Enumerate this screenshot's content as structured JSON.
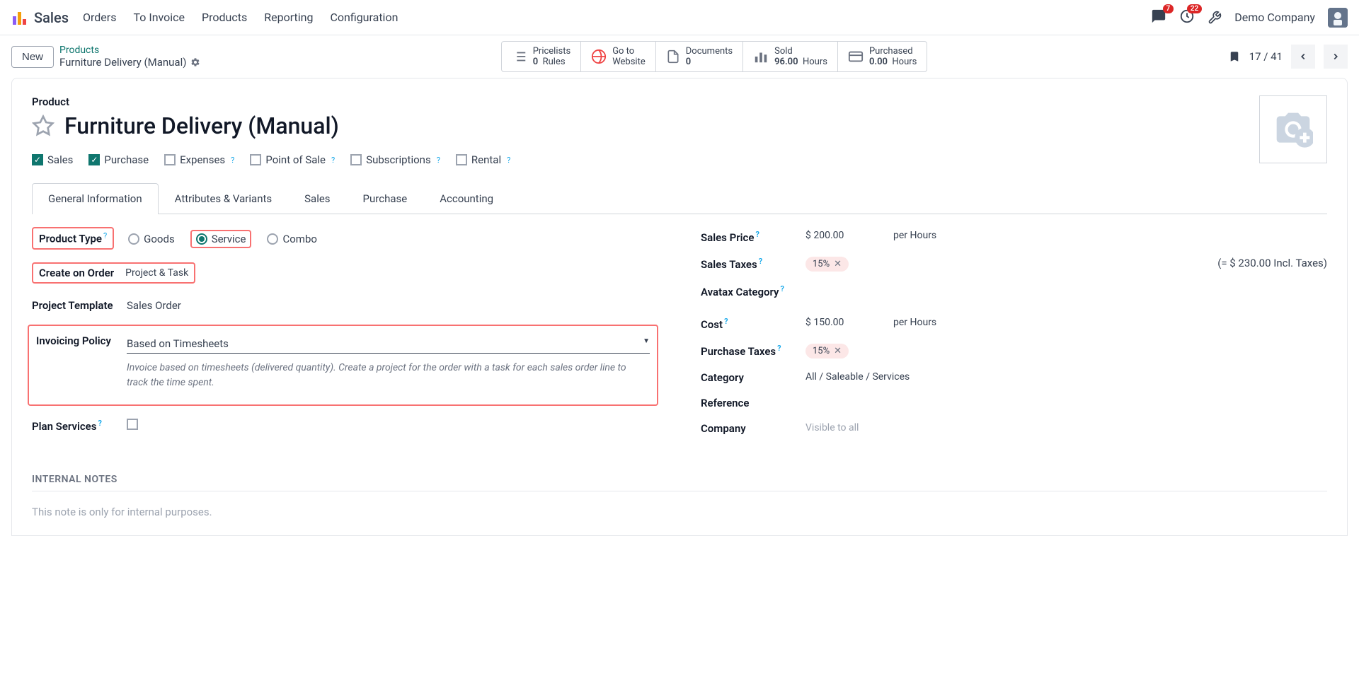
{
  "nav": {
    "app": "Sales",
    "items": [
      "Orders",
      "To Invoice",
      "Products",
      "Reporting",
      "Configuration"
    ],
    "messages_badge": "7",
    "activities_badge": "22",
    "company": "Demo Company"
  },
  "control": {
    "new": "New",
    "breadcrumb_link": "Products",
    "breadcrumb_title": "Furniture Delivery (Manual)",
    "stats": {
      "pricelists": {
        "label": "Pricelists",
        "count": "0",
        "unit": "Rules"
      },
      "goto": {
        "label": "Go to",
        "unit": "Website"
      },
      "documents": {
        "label": "Documents",
        "count": "0"
      },
      "sold": {
        "label": "Sold",
        "value": "96.00",
        "unit": "Hours"
      },
      "purchased": {
        "label": "Purchased",
        "value": "0.00",
        "unit": "Hours"
      }
    },
    "pager": "17 / 41"
  },
  "form": {
    "label": "Product",
    "title": "Furniture Delivery (Manual)",
    "options": {
      "sales": "Sales",
      "purchase": "Purchase",
      "expenses": "Expenses",
      "pos": "Point of Sale",
      "subscriptions": "Subscriptions",
      "rental": "Rental"
    },
    "tabs": [
      "General Information",
      "Attributes & Variants",
      "Sales",
      "Purchase",
      "Accounting"
    ],
    "left": {
      "product_type": {
        "label": "Product Type",
        "options": {
          "goods": "Goods",
          "service": "Service",
          "combo": "Combo"
        }
      },
      "create_on_order": {
        "label": "Create on Order",
        "value": "Project & Task"
      },
      "project_template": {
        "label": "Project Template",
        "value": "Sales Order"
      },
      "invoicing_policy": {
        "label": "Invoicing Policy",
        "value": "Based on Timesheets",
        "help": "Invoice based on timesheets (delivered quantity). Create a project for the order with a task for each sales order line to track the time spent."
      },
      "plan_services": {
        "label": "Plan Services"
      }
    },
    "right": {
      "sales_price": {
        "label": "Sales Price",
        "value": "$ 200.00",
        "unit": "per Hours"
      },
      "sales_taxes": {
        "label": "Sales Taxes",
        "tag": "15%",
        "incl": "(= $ 230.00 Incl. Taxes)"
      },
      "avatax": {
        "label": "Avatax Category"
      },
      "cost": {
        "label": "Cost",
        "value": "$ 150.00",
        "unit": "per Hours"
      },
      "purchase_taxes": {
        "label": "Purchase Taxes",
        "tag": "15%"
      },
      "category": {
        "label": "Category",
        "value": "All / Saleable / Services"
      },
      "reference": {
        "label": "Reference"
      },
      "company": {
        "label": "Company",
        "value": "Visible to all"
      }
    },
    "notes": {
      "title": "INTERNAL NOTES",
      "placeholder": "This note is only for internal purposes."
    }
  }
}
